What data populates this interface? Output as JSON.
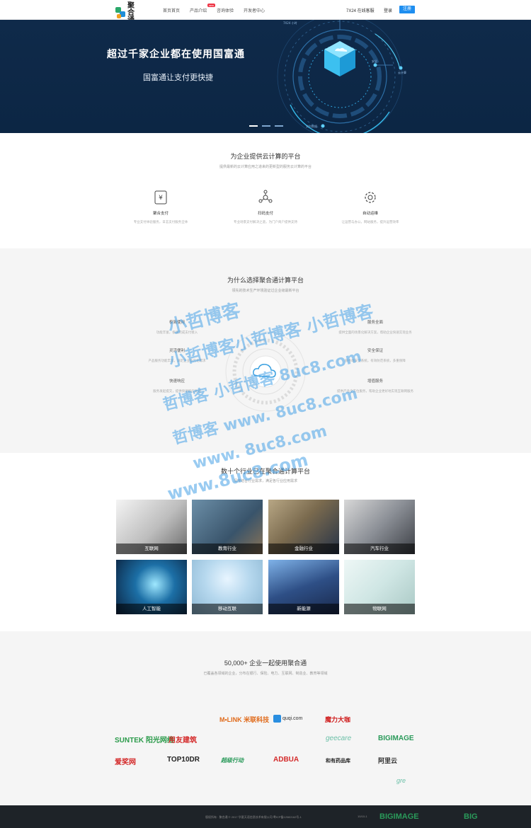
{
  "header": {
    "logo_text": "聚合通",
    "nav": [
      "首页首页",
      "产品介绍",
      "咨询体验",
      "开发者中心"
    ],
    "nav_badge": "new",
    "hotline": "7X24 在线客服",
    "login": "登录",
    "register": "注册"
  },
  "hero": {
    "title": "超过千家企业都在使用国富通",
    "subtitle": "国富通让支付更快捷",
    "label_top": "7X24 小时",
    "label_right1": "安全",
    "label_right2": "云计算",
    "label_bottom": "实时数据"
  },
  "section1": {
    "title": "为企业提供云计算的平台",
    "desc": "提供最新的云计算应用之道来的更新型的服务云计算的平台",
    "features": [
      {
        "icon": "yuan-payment-icon",
        "title": "聚合支付",
        "desc": "专业支付体验服务，日志支付服务全体"
      },
      {
        "icon": "network-icon",
        "title": "扫码支付",
        "desc": "专业场景支付解决之道，为门户商户提供支持"
      },
      {
        "icon": "gear-icon",
        "title": "自动运维",
        "desc": "让运营与办公，网站服务，提升运营效率"
      }
    ]
  },
  "section2": {
    "title": "为什么选择聚合通计算平台",
    "desc": "领先的技术生产环境验证过企业级最新平台",
    "items": [
      {
        "title": "极简使用",
        "desc": "功能丰富，极速完成支付接入"
      },
      {
        "title": "灵活便利",
        "desc": "产品服务功能丰富，满足企业多元化需求"
      },
      {
        "title": "快速响应",
        "desc": "服务发起提交，提供快速响应处理"
      },
      {
        "title": "服务全面",
        "desc": "提供全面的场景化解决方案，帮助企业快速实现业务"
      },
      {
        "title": "安全保证",
        "desc": "服务端安全系统，有效防范系统，多重保障"
      },
      {
        "title": "增值服务",
        "desc": "提供产品全方位服务，帮助企业更好地实现互联网服务"
      }
    ]
  },
  "section3": {
    "title": "数十个行业已在聚合通计算平台",
    "desc": "深度结合行业需求，满足各行业应用需求",
    "tiles": [
      "互联网",
      "教育行业",
      "金融行业",
      "汽车行业",
      "人工智能",
      "移动互联",
      "新能源",
      "物联网"
    ]
  },
  "section4": {
    "title": "50,000+ 企业一起使用聚合通",
    "desc": "已覆盖各领域的企业，分布在银行、保险、电力、互联网、制造业、教育等领域",
    "brands_row1": [
      "M•LINK 米联科技",
      "quqi.com",
      "魔力大咖"
    ],
    "brands_row2": [
      "SUNTEK 阳光网络",
      "用友建筑",
      "geecare",
      "BIGIMAGE"
    ],
    "brands_row3": [
      "爱奖网",
      "TOP10DR",
      "超级行动",
      "ADBUA",
      "和有药品库",
      "阿里云"
    ],
    "brands_row4": [
      "gre"
    ]
  },
  "footer": {
    "copyright": "版权所有 · 聚合通 © 2017 华夏天语信息技术有限公司 粤ICP备12082162号-1",
    "right_text": "10/10-1",
    "brand1": "BIGIMAGE",
    "brand2": "BIG"
  },
  "watermark": {
    "lines": [
      "小哲博客",
      "小哲博客小哲博客 小哲博客",
      "哲博客 小哲博客 8uc8.com",
      "哲博客 www. 8uc8.com",
      "www. 8uc8.com",
      "www.8uc8.com"
    ]
  },
  "colors": {
    "hero_bg": "#0f2a4a",
    "accent": "#1e8ef0",
    "footer_bg": "#1e2328",
    "watermark": "#46a0e6"
  }
}
